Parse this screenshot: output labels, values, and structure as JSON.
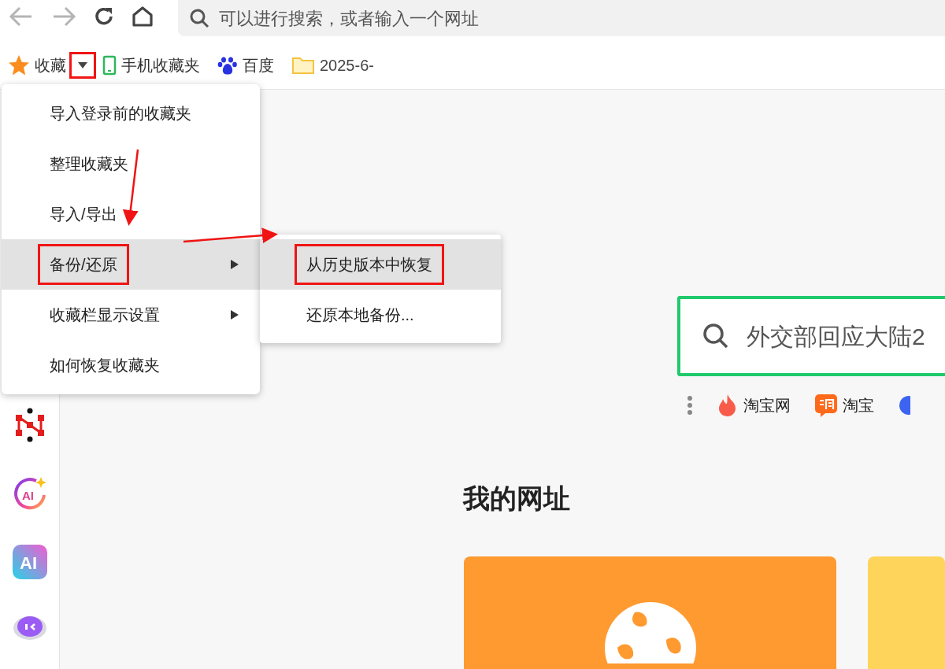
{
  "toolbar": {
    "back_disabled": true,
    "forward_disabled": true,
    "address_placeholder": "可以进行搜索，或者输入一个网址"
  },
  "bookmarks_bar": {
    "favorites_label": "收藏",
    "dropdown_annotated": true,
    "items": [
      {
        "kind": "phone",
        "label": "手机收藏夹"
      },
      {
        "kind": "paw",
        "label": "百度"
      },
      {
        "kind": "folder",
        "label": "2025-6-"
      }
    ]
  },
  "menu": {
    "items": [
      {
        "label": "导入登录前的收藏夹",
        "submenu": false,
        "selected": false,
        "annotated": false
      },
      {
        "label": "整理收藏夹",
        "submenu": false,
        "selected": false,
        "annotated": false
      },
      {
        "label": "导入/导出",
        "submenu": false,
        "selected": false,
        "annotated": false
      },
      {
        "label": "备份/还原",
        "submenu": true,
        "selected": true,
        "annotated": true
      },
      {
        "label": "收藏栏显示设置",
        "submenu": true,
        "selected": false,
        "annotated": false
      },
      {
        "label": "如何恢复收藏夹",
        "submenu": false,
        "selected": false,
        "annotated": false
      }
    ]
  },
  "submenu": {
    "items": [
      {
        "label": "从历史版本中恢复",
        "selected": true,
        "annotated": true
      },
      {
        "label": "还原本地备份...",
        "selected": false,
        "annotated": false
      }
    ]
  },
  "search": {
    "value": "外交部回应大陆2"
  },
  "quick_links": [
    {
      "kind": "flame",
      "label": "淘宝网"
    },
    {
      "kind": "tao",
      "label": "淘宝"
    }
  ],
  "section_title": "我的网址",
  "sidebar_apps": [
    {
      "kind": "network"
    },
    {
      "kind": "ai_ring",
      "text": "AI"
    },
    {
      "kind": "ai_app",
      "text": "AI"
    },
    {
      "kind": "robot"
    }
  ]
}
